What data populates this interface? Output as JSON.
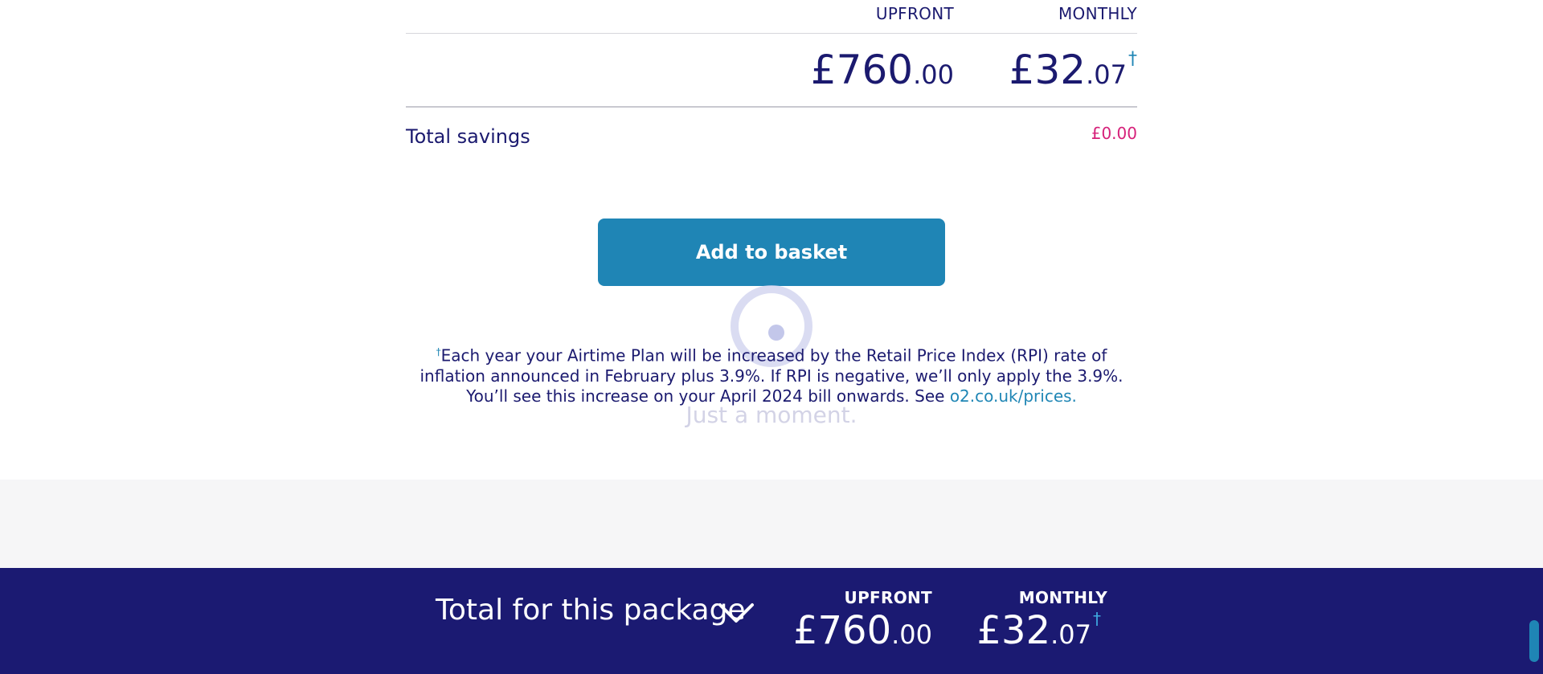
{
  "summary": {
    "upfront_label": "UPFRONT",
    "monthly_label": "MONTHLY",
    "upfront_price_main": "£760",
    "upfront_price_pence": ".00",
    "monthly_price_main": "£32",
    "monthly_price_pence": ".07",
    "dagger": "†",
    "savings_label": "Total savings",
    "savings_value": "£0.00"
  },
  "actions": {
    "add_to_basket_label": "Add to basket"
  },
  "loading": {
    "text": "Just a moment."
  },
  "disclaimer": {
    "dagger": "†",
    "text": "Each year your Airtime Plan will be increased by the Retail Price Index (RPI) rate of inflation announced in February plus 3.9%. If RPI is negative, we’ll only apply the 3.9%. You’ll see this increase on your April 2024 bill onwards. See ",
    "link_text": "o2.co.uk/prices."
  },
  "footer": {
    "title": "Total for this package",
    "upfront_label": "UPFRONT",
    "monthly_label": "MONTHLY",
    "upfront_price_main": "£760",
    "upfront_price_pence": ".00",
    "monthly_price_main": "£32",
    "monthly_price_pence": ".07",
    "dagger": "†"
  },
  "colors": {
    "navy": "#1b1a72",
    "button_blue": "#1f85b5",
    "savings_pink": "#d6217a",
    "link_blue": "#1f86b5"
  },
  "icons": {
    "expand": "chevron-down-icon",
    "loading": "loading-spinner-icon"
  }
}
